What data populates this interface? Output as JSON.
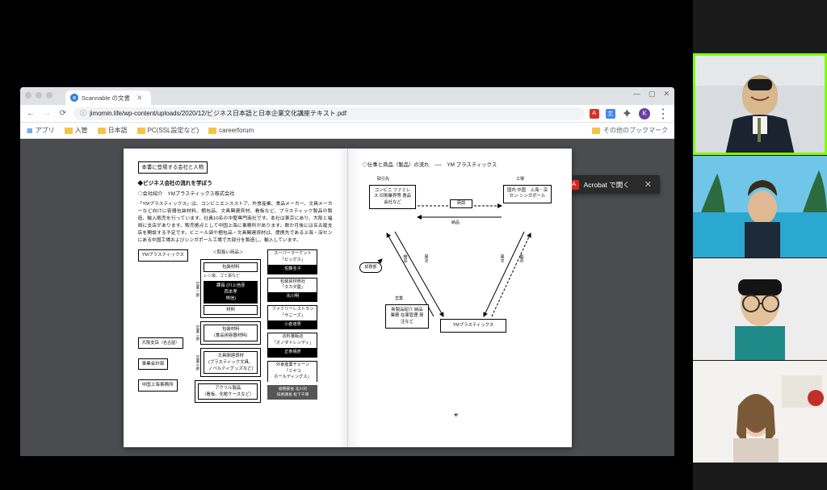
{
  "browser": {
    "tab_title": "Scannable の文書",
    "url": "jimomin.life/wp-content/uploads/2020/12/ビジネス日本語と日本企業文化講座テキスト.pdf",
    "profile_initial": "K",
    "bookmarks": {
      "apps": "アプリ",
      "b1": "入管",
      "b2": "日本語",
      "b3": "PC(SSL設定など)",
      "b4": "careerforum",
      "other": "その他のブックマーク"
    },
    "window_min": "—",
    "window_max": "▢",
    "window_close": "✕"
  },
  "acrobat": {
    "label": "Acrobat で開く",
    "close": "✕"
  },
  "page_left": {
    "header_box": "本書に登場する会社と人物",
    "sub_title": "◆ビジネス会社の流れを学ぼう",
    "company_line": "◇会社紹介　YMプラスティックス株式会社",
    "para": "「YMプラスティックス」は、コンビニエンスストア、外食産業、食品メーカー、文具メーカーなど向けに容器包装材料、梱包品、文具関連資材、看板など、プラスティック製品の製造、輸入販売を行っています。社員10名の中堅専門商社です。本社は東京にあり、大阪と福岡に支店があります。販売拠点として中国上海に事務所があります。数か月後には名古屋支店を開設する予定です。ビニール袋や梱包品・文具関連資材は、提携先である上海・深センにある中国工場およびシンガポール工場で大部分を製造し、輸入しています。",
    "root": "YMプラスティックス",
    "group_hdr": "＜取扱い商品＞",
    "g1_label": "営業一部",
    "g1_cells": {
      "a": "包装材料",
      "b": "レジ袋、ゴミ袋など",
      "b_black": "課長 (川上信彦\\n西本孝\\n林信)",
      "c": "材料"
    },
    "g2_label": "営業二部",
    "g2_cells": {
      "a": "包装材料\\n(食品用容器材料)"
    },
    "g3_label": "営業三部",
    "g3_cells": {
      "a": "文具関連資材\\n(プラスティック文具、\\nノベルティグッズなど)"
    },
    "g4_cells": {
      "a": "アクリル製品\\n（看板、化粧ケースなど）"
    },
    "extra1": "大阪支店",
    "extra1_note": "（名古屋）",
    "extra2": "事業会計部",
    "extra3": "中国上海事務所",
    "right_col": {
      "p0_lbl": "スーパーマーケット\\n「ビッグス」",
      "p0_nm": "佐藤圭子",
      "p1_lbl": "包装資材商社\\n「タカダ屋」",
      "p1_nm": "先川明",
      "p2_lbl": "ファミリーレストラン\\n「サニーズ」",
      "p2_nm": "小倉道男",
      "p3_lbl": "衣料量販店\\n「オノダトレンディ」",
      "p3_nm": "正条晴彦",
      "p4_lbl": "外食産業チェーン\\n「ミヤコ\\nホールディングス」",
      "p5_lbl": "総務部長 北川司\\n技術課長 松下千尋"
    }
  },
  "page_right": {
    "title": "◇仕事と商品（製品）の流れ　──　YM プラスティックス",
    "boxes": {
      "top_left_hdr": "取引先",
      "top_left": "コンビニ\\nファミレス\\n印刷業界等\\n食品会社など",
      "top_center": "商談",
      "top_right_hdr": "工場",
      "top_right": "国内\\n中国　上海・深セン\\nシンガポール",
      "bottom_center": "YMプラスティックス",
      "bottom_left_hdr": "営業",
      "bottom_left": "新製品紹介\\n納品業務\\n在庫管理\\n発注など",
      "left_mid": "総務部"
    },
    "labels": {
      "nouhin": "納品",
      "seizo": "製造",
      "hachuu": "発注",
      "nouhin2": "納品"
    }
  }
}
